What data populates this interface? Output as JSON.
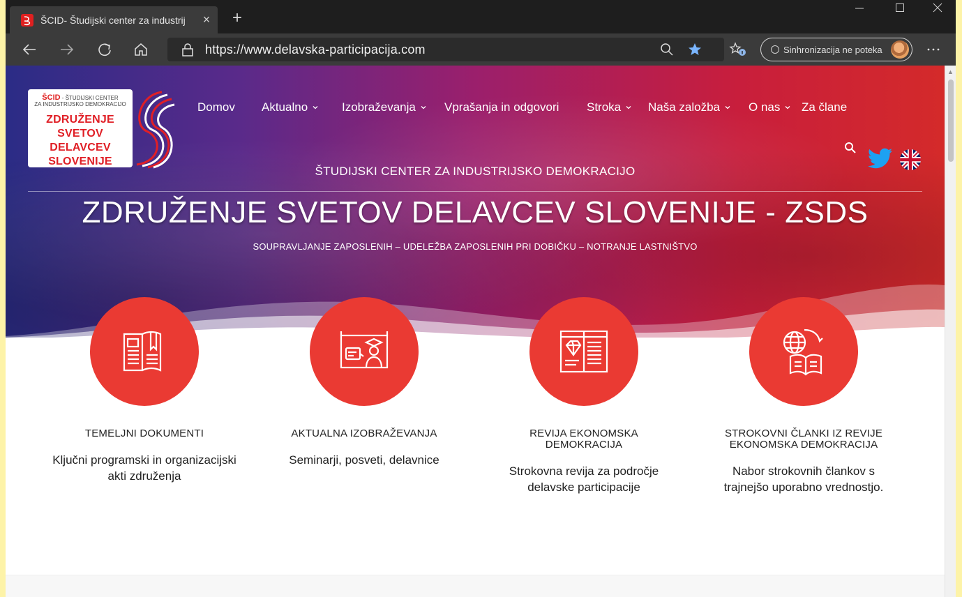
{
  "browser": {
    "tab_title": "ŠCID- Študijski center za industrij",
    "tab_close": "×",
    "new_tab": "+",
    "url": "https://www.delavska-participacija.com",
    "sync_label": "Sinhronizacija ne poteka"
  },
  "site": {
    "logo": {
      "top_brand": "ŠCID",
      "top_line1": " - ŠTUDIJSKI CENTER",
      "top_line2": "ZA INDUSTRIJSKO DEMOKRACIJO",
      "main_line1": "ZDRUŽENJE",
      "main_line2": "SVETOV DELAVCEV",
      "main_line3": "SLOVENIJE"
    },
    "nav": [
      {
        "label": "Domov",
        "dropdown": false
      },
      {
        "label": "Aktualno",
        "dropdown": true
      },
      {
        "label": "Izobraževanja",
        "dropdown": true
      },
      {
        "label": "Vprašanja in odgovori",
        "dropdown": false
      },
      {
        "label": "Stroka",
        "dropdown": true
      },
      {
        "label": "Naša založba",
        "dropdown": true
      },
      {
        "label": "O nas",
        "dropdown": true
      },
      {
        "label": "Za člane",
        "dropdown": false
      }
    ],
    "hero": {
      "subtitle": "ŠTUDIJSKI CENTER ZA INDUSTRIJSKO DEMOKRACIJO",
      "title": "ZDRUŽENJE SVETOV DELAVCEV SLOVENIJE - ZSDS",
      "tagline": "SOUPRAVLJANJE ZAPOSLENIH – UDELEŽBA ZAPOSLENIH PRI DOBIČKU – NOTRANJE LASTNIŠTVO"
    },
    "features": [
      {
        "title": "TEMELJNI DOKUMENTI",
        "desc": "Ključni programski in organizacijski akti združenja",
        "icon": "document-book-icon"
      },
      {
        "title": "AKTUALNA IZOBRAŽEVANJA",
        "desc": "Seminarji, posveti, delavnice",
        "icon": "online-education-icon"
      },
      {
        "title": "REVIJA EKONOMSKA DEMOKRACIJA",
        "desc": "Strokovna revija za področje delavske participacije",
        "icon": "magazine-diamond-icon"
      },
      {
        "title": "STROKOVNI ČLANKI IZ REVIJE EKONOMSKA DEMOKRACIJA",
        "desc": "Nabor strokovnih člankov s trajnejšo uporabno vrednostjo.",
        "icon": "globe-book-icon"
      }
    ]
  },
  "colors": {
    "accent_red": "#ea3a33",
    "brand_red": "#e01f26",
    "hero_blue": "#2b2c86",
    "hero_red": "#d42a2a"
  }
}
